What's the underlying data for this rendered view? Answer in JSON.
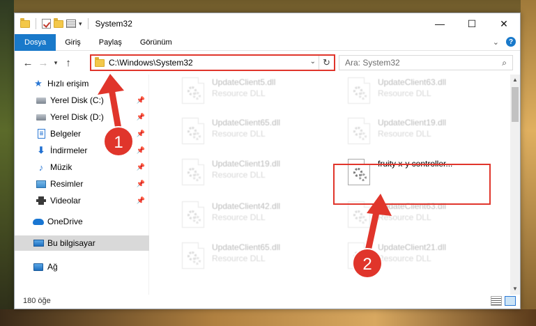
{
  "window": {
    "title": "System32",
    "controls": {
      "minimize": "—",
      "maximize": "☐",
      "close": "✕"
    }
  },
  "ribbon": {
    "tabs": [
      {
        "label": "Dosya",
        "active": true
      },
      {
        "label": "Giriş",
        "active": false
      },
      {
        "label": "Paylaş",
        "active": false
      },
      {
        "label": "Görünüm",
        "active": false
      }
    ],
    "help_label": "?"
  },
  "address": {
    "path": "C:\\Windows\\System32",
    "search_placeholder": "Ara: System32"
  },
  "sidebar": {
    "quick_access": "Hızlı erişim",
    "items": [
      {
        "label": "Yerel Disk (C:)",
        "icon": "drive-icon"
      },
      {
        "label": "Yerel Disk (D:)",
        "icon": "drive-icon"
      },
      {
        "label": "Belgeler",
        "icon": "documents-icon"
      },
      {
        "label": "İndirmeler",
        "icon": "downloads-icon"
      },
      {
        "label": "Müzik",
        "icon": "music-icon"
      },
      {
        "label": "Resimler",
        "icon": "pictures-icon"
      },
      {
        "label": "Videolar",
        "icon": "videos-icon"
      }
    ],
    "onedrive": "OneDrive",
    "this_pc": "Bu bilgisayar",
    "network": "Ağ"
  },
  "files": {
    "left": [
      {
        "name": "UpdateClient5.dll",
        "type": "Resource DLL"
      },
      {
        "name": "UpdateClient65.dll",
        "type": "Resource DLL"
      },
      {
        "name": "UpdateClient19.dll",
        "type": "Resource DLL"
      },
      {
        "name": "UpdateClient42.dll",
        "type": "Resource DLL"
      },
      {
        "name": "UpdateClient65.dll",
        "type": "Resource DLL"
      }
    ],
    "right": [
      {
        "name": "UpdateClient63.dll",
        "type": "Resource DLL"
      },
      {
        "name": "UpdateClient19.dll",
        "type": "Resource DLL"
      },
      {
        "name": "fruity x-y controller...",
        "type": ""
      },
      {
        "name": "UpdateClient63.dll",
        "type": "Resource DLL"
      },
      {
        "name": "UpdateClient21.dll",
        "type": "Resource DLL"
      }
    ]
  },
  "status": {
    "count": "180 öğe"
  },
  "annotations": {
    "badge1": "1",
    "badge2": "2",
    "color": "#e0352b"
  }
}
